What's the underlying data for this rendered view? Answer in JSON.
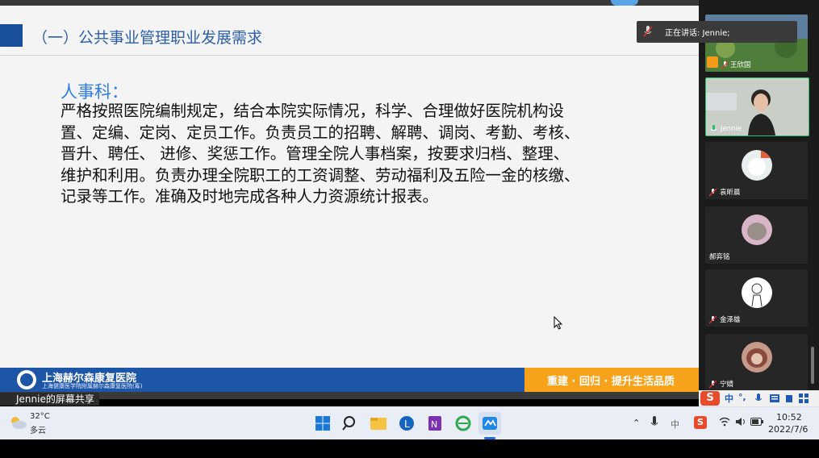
{
  "slide": {
    "title": "（一）公共事业管理职业发展需求",
    "section_heading": "人事科：",
    "body_lines": [
      "严格按照医院编制规定，结合本院实际情况，科学、合理做好医院机构设",
      "置、定编、定岗、定员工作。负责员工的招聘、解聘、调岗、考勤、考核、",
      "晋升、聘任、 进修、奖惩工作。管理全院人事档案，按要求归档、整理、",
      "维护和利用。负责办理全院职工的工资调整、劳动福利及五险一金的核缴、",
      "记录等工作。准确及时地完成各种人力资源统计报表。"
    ],
    "footer": {
      "hospital_name": "上海赫尔森康复医院",
      "hospital_sub": "上海健康医学院附属赫尔森康复医院(筹)",
      "slogan": "重建 · 回归 · 提升生活品质"
    }
  },
  "meeting": {
    "share_label": "Jennie的屏幕共享",
    "speaking_label": "正在讲话: Jennie;",
    "participants": [
      {
        "name": "王欣国"
      },
      {
        "name": "Jennie"
      },
      {
        "name": "袁昕晨"
      },
      {
        "name": "郝弈铭"
      },
      {
        "name": "金泽雄"
      },
      {
        "name": "宁婧"
      }
    ]
  },
  "ime": {
    "logo": "S",
    "mode": "中",
    "punct": "°,"
  },
  "taskbar": {
    "weather_temp": "32°C",
    "weather_desc": "多云",
    "time": "10:52",
    "date": "2022/7/6",
    "tray_lang": "中"
  },
  "colors": {
    "title_blue": "#2d5fa8",
    "heading_blue": "#2f7de1",
    "footer_blue": "#1d55a7",
    "footer_orange": "#f7a21b"
  }
}
